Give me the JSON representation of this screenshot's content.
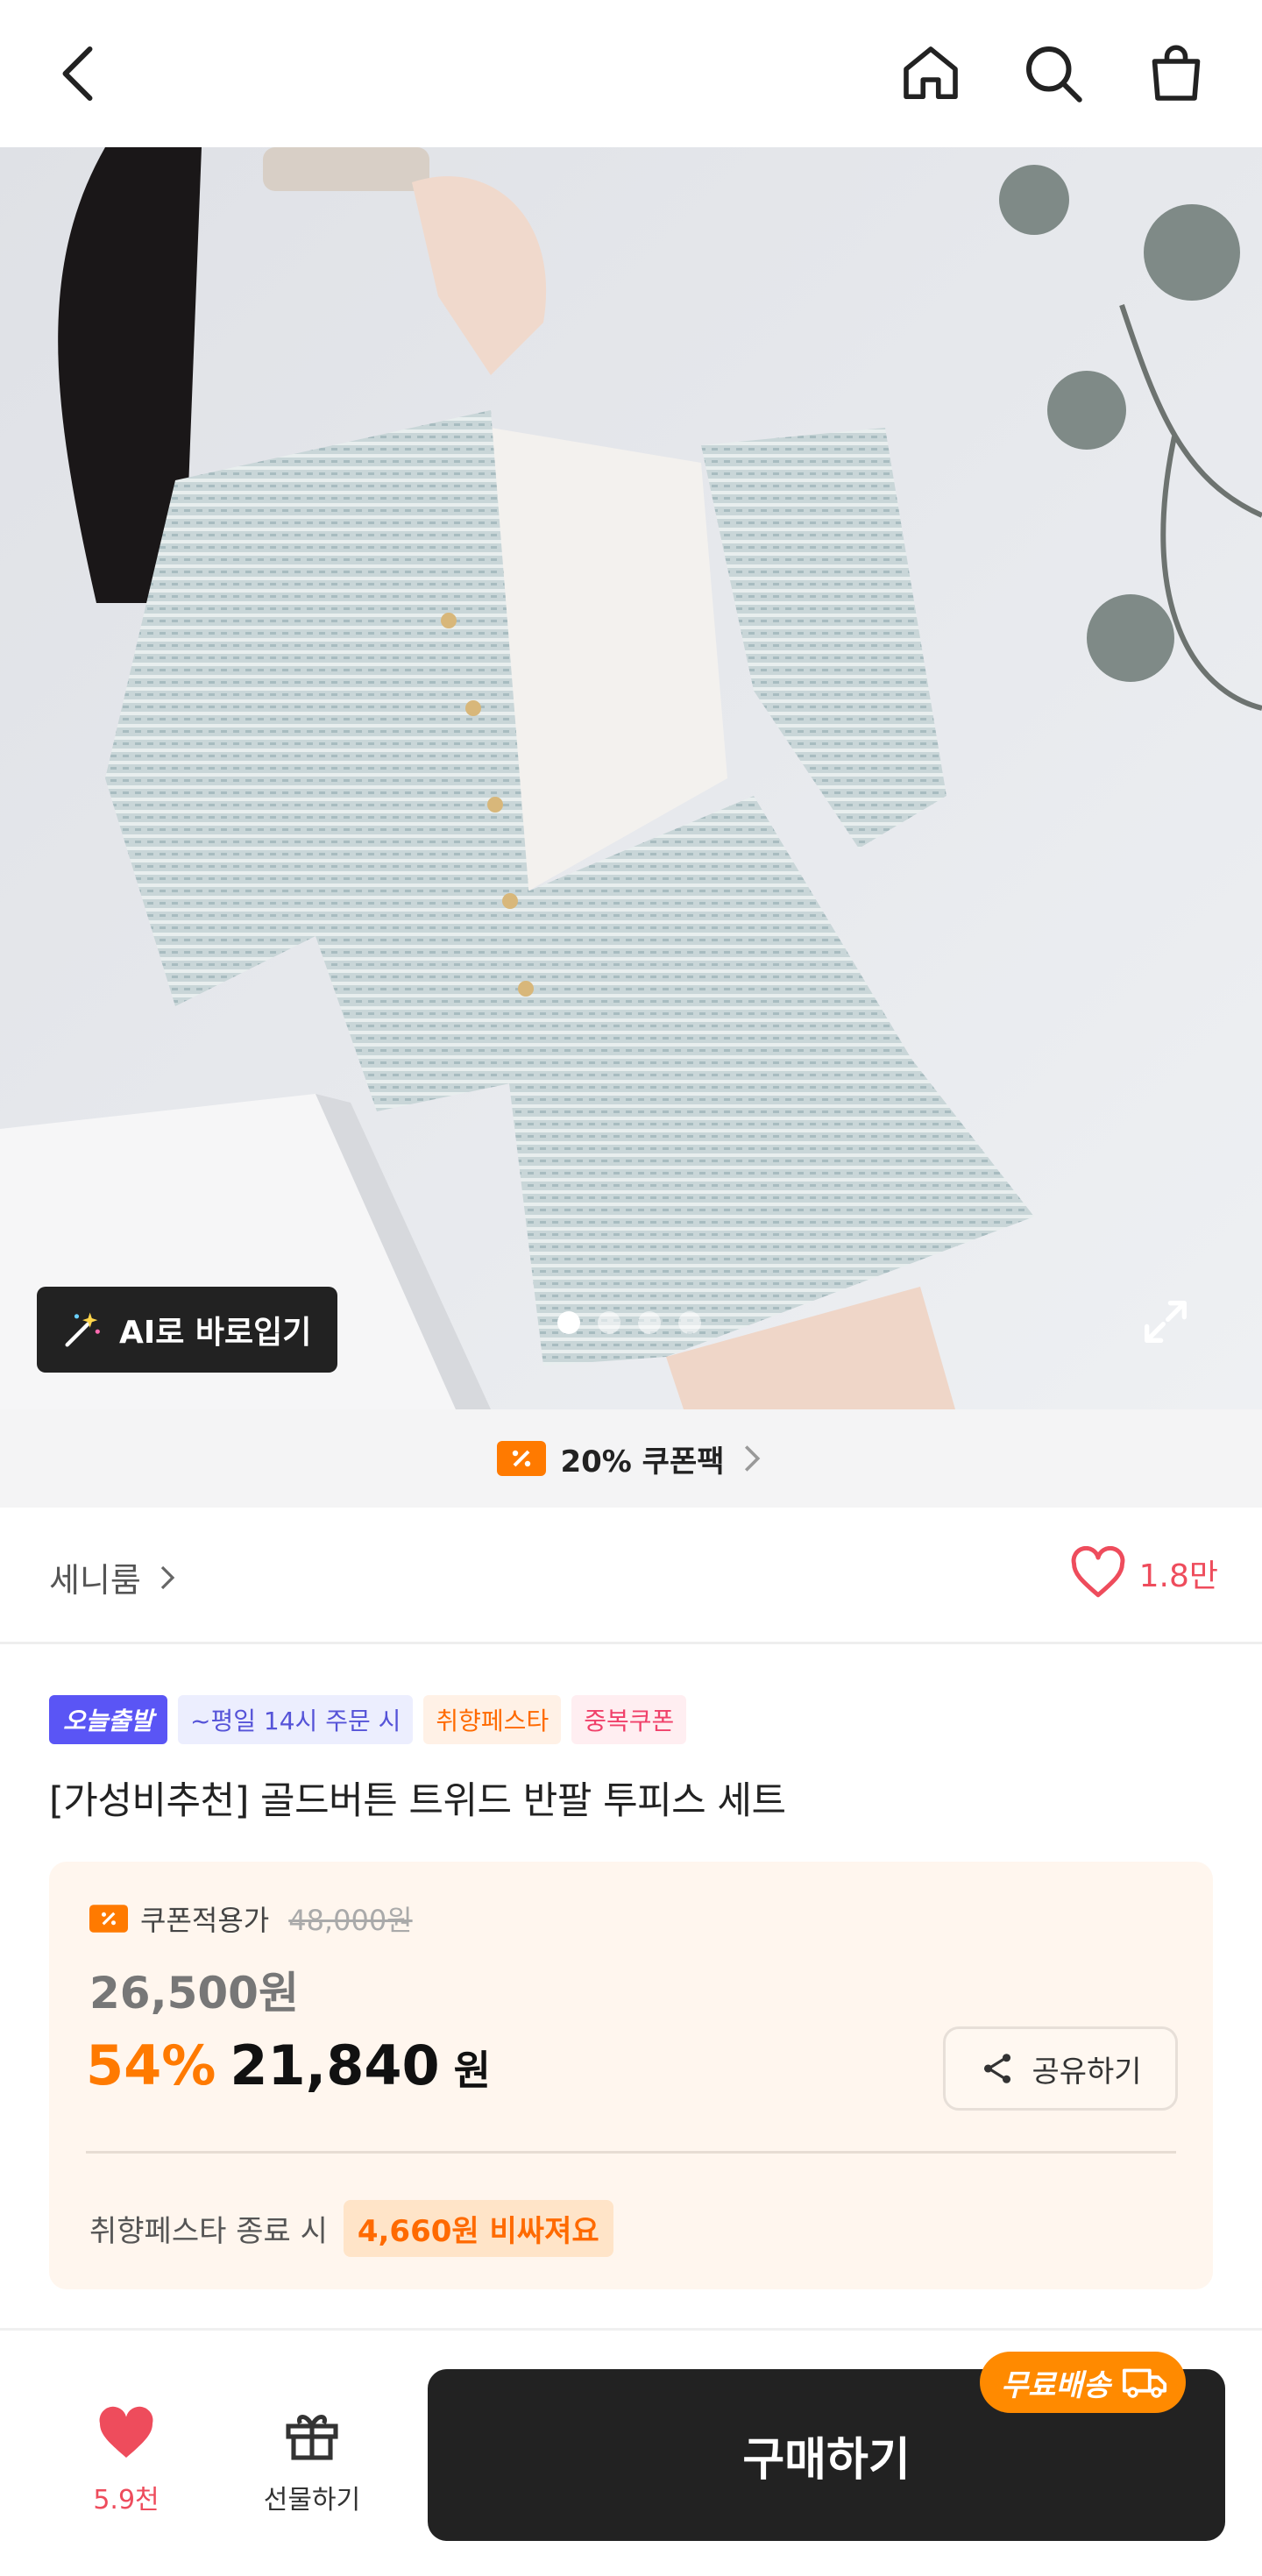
{
  "header": {
    "icons": [
      "back-icon",
      "home-icon",
      "search-icon",
      "shopping-bag-icon"
    ]
  },
  "hero": {
    "ai_button_label": "AI로 바로입기",
    "carousel_total": 4,
    "carousel_active_index": 0
  },
  "coupon_bar": {
    "label": "20% 쿠폰팩"
  },
  "brand": {
    "name": "세니룸",
    "like_count": "1.8만"
  },
  "badges": [
    "오늘출발",
    "~평일 14시 주문 시",
    "취향페스타",
    "중복쿠폰"
  ],
  "product": {
    "title": "[가성비추천] 골드버튼 트위드 반팔 투피스 세트"
  },
  "price": {
    "coupon_label": "쿠폰적용가",
    "original_price": "48,000원",
    "sale_price": "26,500원",
    "discount_percent": "54%",
    "final_price": "21,840",
    "currency": "원",
    "share_label": "공유하기",
    "festa_note": "취향페스타 종료 시",
    "festa_highlight": "4,660원 비싸져요"
  },
  "bottom_bar": {
    "wish_count": "5.9천",
    "gift_label": "선물하기",
    "buy_label": "구매하기",
    "free_shipping_label": "무료배송"
  },
  "colors": {
    "accent_orange": "#ff7a00",
    "like_red": "#ee4c5c",
    "buy_button": "#222222",
    "price_box_bg": "#fff6ee",
    "badge_purple": "#5a55f5"
  }
}
